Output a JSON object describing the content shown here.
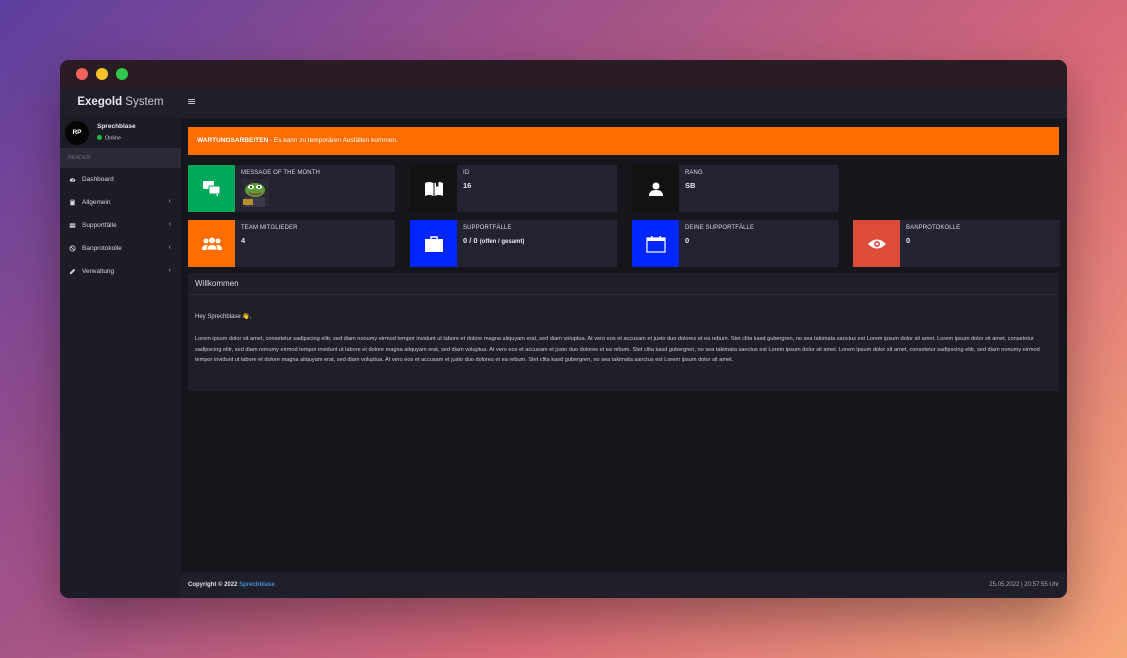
{
  "window": {
    "controls": [
      "close",
      "minimize",
      "maximize"
    ]
  },
  "brand": {
    "bold": "Exegold",
    "light": "System"
  },
  "topbar": {
    "menu_icon": "≡"
  },
  "user": {
    "initials": "RP",
    "name": "Sprechblase",
    "status": "Online"
  },
  "sidebar": {
    "header": "HEADER",
    "items": [
      {
        "label": "Dashboard",
        "icon": "dashboard-icon",
        "has_submenu": false
      },
      {
        "label": "Allgemein",
        "icon": "book-icon",
        "has_submenu": true
      },
      {
        "label": "Supportfälle",
        "icon": "ticket-icon",
        "has_submenu": true
      },
      {
        "label": "Banprotokolle",
        "icon": "ban-icon",
        "has_submenu": true
      },
      {
        "label": "Verwaltung",
        "icon": "pencil-icon",
        "has_submenu": true
      }
    ],
    "chevron": "‹"
  },
  "alert": {
    "title": "WARTUNGSARBEITEN",
    "text": " - Es kann zu temporären Ausfällen kommen.",
    "color": "#ff6d00"
  },
  "info_boxes": [
    {
      "title": "MESSAGE OF THE MONTH",
      "value": "",
      "icon": "chat-icon",
      "color": "#00a85a"
    },
    {
      "title": "ID",
      "value": "16",
      "icon": "book-open-icon",
      "color": "#121212"
    },
    {
      "title": "RANG",
      "value": "SB",
      "icon": "user-icon",
      "color": "#121212"
    },
    {
      "title": "TEAM MITGLIEDER",
      "value": "4",
      "icon": "users-icon",
      "color": "#ff6d00"
    },
    {
      "title": "SUPPORTFÄLLE",
      "value": "0 / 0",
      "value_suffix": "(offen / gesamt)",
      "icon": "briefcase-icon",
      "color": "#0026ff"
    },
    {
      "title": "DEINE SUPPORTFÄLLE",
      "value": "0",
      "icon": "calendar-icon",
      "color": "#0026ff"
    },
    {
      "title": "BANPROTOKOLLE",
      "value": "0",
      "icon": "eye-icon",
      "color": "#dd4b39"
    }
  ],
  "welcome": {
    "title": "Willkommen",
    "greeting": "Hey Sprechblase 👋,",
    "body": "Lorem ipsum dolor sit amet, consetetur sadipscing elitr, sed diam nonumy eirmod tempor invidunt ut labore et dolore magna aliquyam erat, sed diam voluptua. At vero eos et accusam et justo duo dolores et ea rebum. Stet clita kasd gubergren, no sea takimata sanctus est Lorem ipsum dolor sit amet. Lorem ipsum dolor sit amet, consetetur sadipscing elitr, sed diam nonumy eirmod tempor invidunt ut labore et dolore magna aliquyam erat, sed diam voluptua. At vero eos et accusam et justo duo dolores et ea rebum. Stet clita kasd gubergren, no sea takimata sanctus est Lorem ipsum dolor sit amet. Lorem ipsum dolor sit amet, consetetur sadipscing elitr, sed diam nonumy eirmod tempor invidunt ut labore et dolore magna aliquyam erat, sed diam voluptua. At vero eos et accusam et justo duo dolores et ea rebum. Stet clita kasd gubergren, no sea takimata sanctus est Lorem ipsum dolor sit amet."
  },
  "footer": {
    "copyright": "Copyright © 2022 ",
    "link": "Sprechblase",
    "datetime": "25.05.2022 | 20:57:55 Uhr"
  }
}
